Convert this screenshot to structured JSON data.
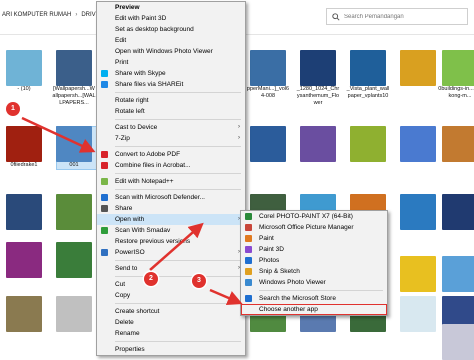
{
  "breadcrumb": [
    "ARI KOMPUTER RUMAH",
    "DRIVE H"
  ],
  "search": {
    "placeholder": "Search Pemandangan"
  },
  "tiles": [
    {
      "caption": "",
      "color": "#6fb3d6"
    },
    {
      "caption": "",
      "color": "#ffffff"
    },
    {
      "caption": "",
      "color": "#ffffff"
    },
    {
      "caption": "",
      "color": "#3b5f8a"
    },
    {
      "caption": "",
      "color": "#274a7a"
    },
    {
      "caption": "",
      "color": "#1d3f75"
    },
    {
      "caption": "",
      "color": "#ffffff"
    },
    {
      "caption": "",
      "color": "#ffffff"
    },
    {
      "caption": "",
      "color": "#ffffff"
    },
    {
      "caption": "",
      "color": "#3a6ea5"
    },
    {
      "caption": "- (10)",
      "color": "#1e2a4a"
    },
    {
      "caption": "[Wallpapersh...Wallpapersh...[WALLPAPERS...",
      "color": "#4f8f3a"
    },
    {
      "caption": "",
      "color": "#ffffff"
    },
    {
      "caption": "",
      "color": "#ffffff"
    },
    {
      "caption": "pperMani...]_vol64-008",
      "color": "#1f5f9a"
    },
    {
      "caption": "_1280_1024_Chrysanthemum_Flower",
      "color": "#d9a020"
    },
    {
      "caption": "_Vista_plant_wallpaper_vplants10",
      "color": "#7fc04a"
    },
    {
      "caption": "",
      "color": "#6e4a2a"
    },
    {
      "caption": "0buildings-in...ng-kong-m...",
      "color": "#3a3f6e"
    },
    {
      "caption": "",
      "color": "#a02010"
    },
    {
      "caption": "",
      "color": "#4f87c2"
    },
    {
      "caption": "",
      "color": "#ffffff"
    },
    {
      "caption": "",
      "color": "#ffffff"
    },
    {
      "caption": "",
      "color": "#2b5c9b"
    },
    {
      "caption": "",
      "color": "#6a4ea0"
    },
    {
      "caption": "",
      "color": "#8fb030"
    },
    {
      "caption": "",
      "color": "#4a7ad0"
    },
    {
      "caption": "",
      "color": "#c27a30"
    },
    {
      "caption": "0fiiedrake1",
      "color": "#b03010"
    },
    {
      "caption": "001",
      "color": "#d8e4f0"
    },
    {
      "caption": "",
      "color": "#ffffff"
    },
    {
      "caption": "",
      "color": "#ffffff"
    },
    {
      "caption": "",
      "color": "#2a4a7a"
    },
    {
      "caption": "",
      "color": "#5a8c3a"
    },
    {
      "caption": "",
      "color": "#3f5f3f"
    },
    {
      "caption": "",
      "color": "#3f9ad0"
    },
    {
      "caption": "",
      "color": "#d07020"
    },
    {
      "caption": "",
      "color": "#2b7ac0"
    },
    {
      "caption": "",
      "color": "#203a70"
    },
    {
      "caption": "",
      "color": "#8a2a80"
    },
    {
      "caption": "",
      "color": "#3a7d3a"
    },
    {
      "caption": "",
      "color": "#1a4fa0"
    },
    {
      "caption": "",
      "color": "#60a0e0"
    },
    {
      "caption": "",
      "color": "#2a5a2a"
    },
    {
      "caption": "",
      "color": "#e8c020"
    },
    {
      "caption": "",
      "color": "#5aa0d8"
    },
    {
      "caption": "",
      "color": "#8a7a50"
    },
    {
      "caption": "",
      "color": "#c0c0c0"
    },
    {
      "caption": "",
      "color": "#ffffff"
    },
    {
      "caption": "",
      "color": "#ffffff"
    },
    {
      "caption": "",
      "color": "#ffffff"
    },
    {
      "caption": "",
      "color": "#ffffff"
    },
    {
      "caption": "",
      "color": "#d8e8f0"
    },
    {
      "caption": "",
      "color": "#304a8a"
    },
    {
      "caption": "",
      "color": "#508a40"
    },
    {
      "caption": "",
      "color": "#5a7ab0"
    },
    {
      "caption": "",
      "color": "#3a6a3a"
    },
    {
      "caption": "",
      "color": "#c8c8d8"
    }
  ],
  "context_menu": {
    "items": [
      {
        "label": "Preview",
        "bold": true,
        "icon": "",
        "arrow": false
      },
      {
        "label": "Edit with Paint 3D",
        "icon": "",
        "arrow": false
      },
      {
        "label": "Set as desktop background",
        "icon": "",
        "arrow": false
      },
      {
        "label": "Edit",
        "icon": "",
        "arrow": false
      },
      {
        "label": "Open with Windows Photo Viewer",
        "icon": "",
        "arrow": false
      },
      {
        "label": "Print",
        "icon": "",
        "arrow": false
      },
      {
        "label": "Share with Skype",
        "icon": "skype-icon",
        "color": "#00aff0",
        "arrow": false
      },
      {
        "label": "Share files via SHAREit",
        "icon": "shareit-icon",
        "color": "#1e88e5",
        "arrow": false
      },
      {
        "sep": true
      },
      {
        "label": "Rotate right",
        "icon": "",
        "arrow": false
      },
      {
        "label": "Rotate left",
        "icon": "",
        "arrow": false
      },
      {
        "sep": true
      },
      {
        "label": "Cast to Device",
        "icon": "",
        "arrow": true
      },
      {
        "label": "7-Zip",
        "icon": "",
        "arrow": true
      },
      {
        "sep": true
      },
      {
        "label": "Convert to Adobe PDF",
        "icon": "pdf-icon",
        "color": "#d8232a",
        "arrow": false
      },
      {
        "label": "Combine files in Acrobat...",
        "icon": "acrobat-icon",
        "color": "#d8232a",
        "arrow": false
      },
      {
        "sep": true
      },
      {
        "label": "Edit with Notepad++",
        "icon": "notepad-icon",
        "color": "#7ab648",
        "arrow": false
      },
      {
        "sep": true
      },
      {
        "label": "Scan with Microsoft Defender...",
        "icon": "defender-icon",
        "color": "#1f6fd0",
        "arrow": false
      },
      {
        "label": "Share",
        "icon": "share-icon",
        "color": "#555555",
        "arrow": false
      },
      {
        "label": "Open with",
        "icon": "",
        "arrow": true,
        "highlight": true
      },
      {
        "label": "Scan With Smadav",
        "icon": "smadav-icon",
        "color": "#2e9d3a",
        "arrow": false
      },
      {
        "label": "Restore previous versions",
        "icon": "",
        "arrow": false
      },
      {
        "label": "PowerISO",
        "icon": "poweriso-icon",
        "color": "#3070c0",
        "arrow": true
      },
      {
        "sep": true
      },
      {
        "label": "Send to",
        "icon": "",
        "arrow": true
      },
      {
        "sep": true
      },
      {
        "label": "Cut",
        "icon": "",
        "arrow": false
      },
      {
        "label": "Copy",
        "icon": "",
        "arrow": false
      },
      {
        "sep": true
      },
      {
        "label": "Create shortcut",
        "icon": "",
        "arrow": false
      },
      {
        "label": "Delete",
        "icon": "",
        "arrow": false
      },
      {
        "label": "Rename",
        "icon": "",
        "arrow": false
      },
      {
        "sep": true
      },
      {
        "label": "Properties",
        "icon": "",
        "arrow": false
      }
    ]
  },
  "submenu": {
    "items": [
      {
        "label": "Corel PHOTO-PAINT X7 (64-Bit)",
        "icon": "corel-icon",
        "color": "#2a8a3a"
      },
      {
        "label": "Microsoft Office Picture Manager",
        "icon": "picture-manager-icon",
        "color": "#c8463a"
      },
      {
        "label": "Paint",
        "icon": "paint-icon",
        "color": "#e07a20"
      },
      {
        "label": "Paint 3D",
        "icon": "paint3d-icon",
        "color": "#8a4ad0"
      },
      {
        "label": "Photos",
        "icon": "photos-icon",
        "color": "#1f6fd0"
      },
      {
        "label": "Snip & Sketch",
        "icon": "snip-icon",
        "color": "#e0a020"
      },
      {
        "label": "Windows Photo Viewer",
        "icon": "photo-viewer-icon",
        "color": "#3a8ad0"
      },
      {
        "sep": true
      },
      {
        "label": "Search the Microsoft Store",
        "icon": "store-icon",
        "color": "#1f6fd0"
      },
      {
        "label": "Choose another app",
        "icon": "",
        "boxed": true
      }
    ]
  },
  "badges": [
    "1",
    "2",
    "3"
  ],
  "colors": {
    "accent": "#e0322e",
    "highlight": "#cce4f7"
  }
}
